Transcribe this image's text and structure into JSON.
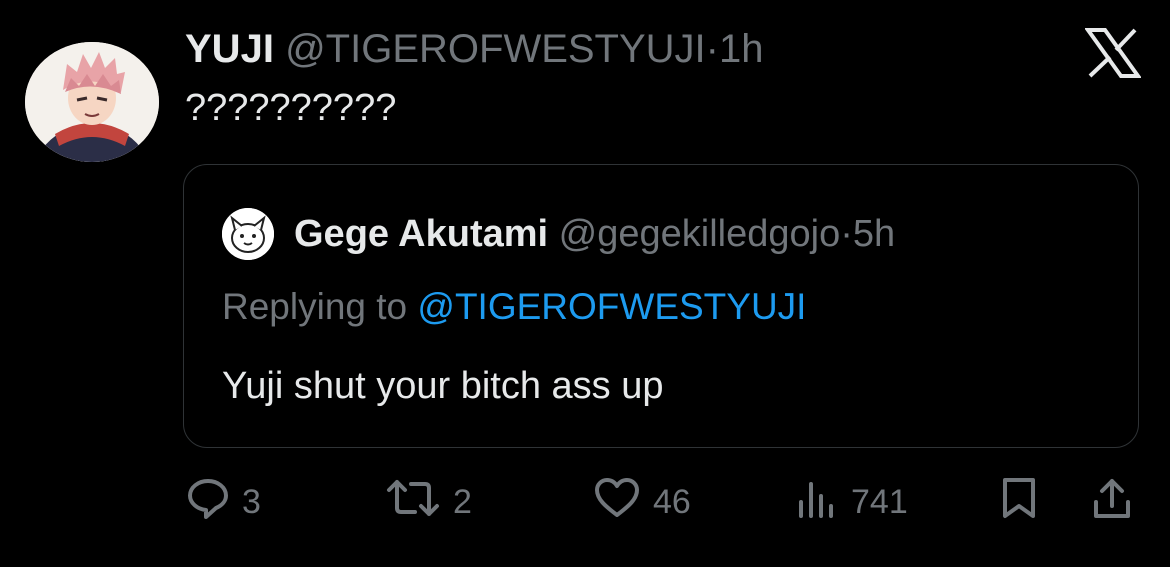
{
  "author": {
    "name": "YUJI",
    "handle": "@TIGEROFWESTYUJI",
    "separator": "·",
    "time": "1h",
    "text": "??????????"
  },
  "quoted": {
    "name": "Gege Akutami",
    "handle": "@gegekilledgojo",
    "separator": "·",
    "time": "5h",
    "replying_label": "Replying to",
    "replying_handle": "@TIGEROFWESTYUJI",
    "text": "Yuji shut your bitch ass up"
  },
  "actions": {
    "replies": "3",
    "reposts": "2",
    "likes": "46",
    "views": "741"
  },
  "colors": {
    "background": "#000000",
    "text": "#e7e9ea",
    "muted": "#71767b",
    "link": "#1d9bf0",
    "border": "#2f3336"
  },
  "icons": [
    "x-logo-icon",
    "reply-icon",
    "repost-icon",
    "like-icon",
    "views-icon",
    "bookmark-icon",
    "share-icon"
  ]
}
